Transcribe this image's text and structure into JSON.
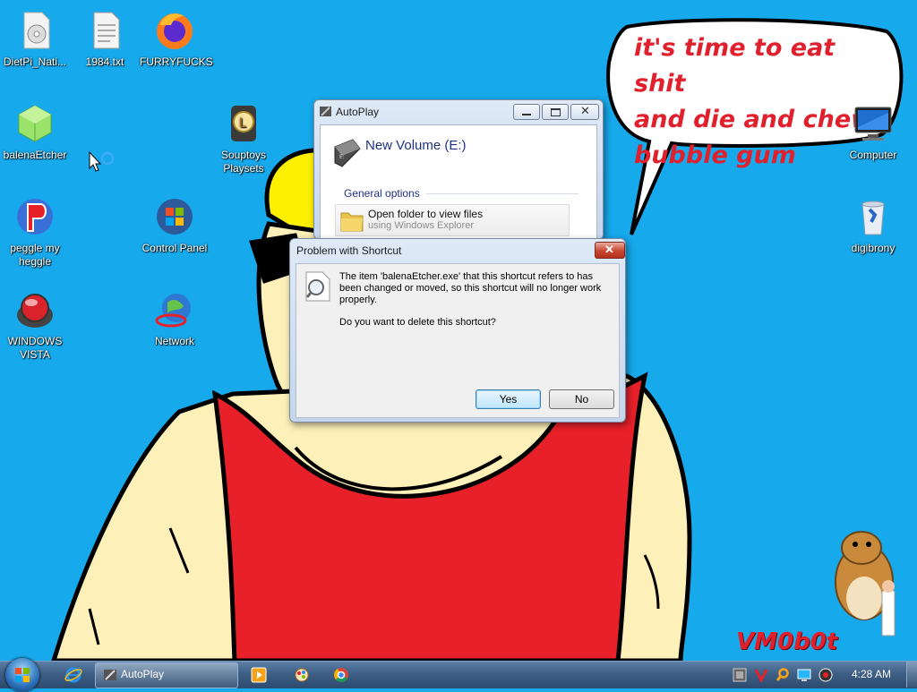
{
  "desktop_icons": [
    {
      "label": "DietPi_Nati...",
      "icon": "cd-file-icon"
    },
    {
      "label": "1984.txt",
      "icon": "text-file-icon"
    },
    {
      "label": "FURRYFUCKS",
      "icon": "firefox-icon"
    },
    {
      "label": "balenaEtcher",
      "icon": "balena-cube-icon"
    },
    {
      "label": "Souptoys Playsets",
      "icon": "souptoys-icon"
    },
    {
      "label": "peggle my heggle",
      "icon": "peggle-icon"
    },
    {
      "label": "Control Panel",
      "icon": "control-panel-icon"
    },
    {
      "label": "WINDOWS VISTA",
      "icon": "vista-orb-icon"
    },
    {
      "label": "Network",
      "icon": "network-globe-icon"
    },
    {
      "label": "Computer",
      "icon": "computer-monitor-icon"
    },
    {
      "label": "digibrony",
      "icon": "recycle-bin-icon"
    }
  ],
  "wallpaper": {
    "speech_bubble_lines": [
      "it's time to eat shit",
      "and die and chew",
      "bubble gum"
    ],
    "signature": "VM0b0t"
  },
  "autoplay": {
    "title": "AutoPlay",
    "drive_label": "New Volume (E:)",
    "section": "General options",
    "option_title": "Open folder to view files",
    "option_sub": "using Windows Explorer"
  },
  "dialog": {
    "title": "Problem with Shortcut",
    "message": "The item 'balenaEtcher.exe' that this shortcut refers to has been changed or moved, so this shortcut will no longer work properly.",
    "question": "Do you want to delete this shortcut?",
    "yes_label": "Yes",
    "no_label": "No"
  },
  "taskbar": {
    "active_task": "AutoPlay",
    "clock": "4:28 AM",
    "pinned": [
      "internet-explorer-icon",
      "media-player-icon",
      "paint-icon",
      "chrome-icon"
    ],
    "tray": [
      "vm-tray-icon",
      "v-tray-icon",
      "search-tray-icon",
      "display-tray-icon",
      "media-tray-icon"
    ]
  },
  "colors": {
    "desktop_bg": "#16a9ec",
    "bubble_text": "#e0202c",
    "shirt": "#e8202a",
    "helmet": "#ffef00",
    "skin": "#fdf0b8"
  }
}
